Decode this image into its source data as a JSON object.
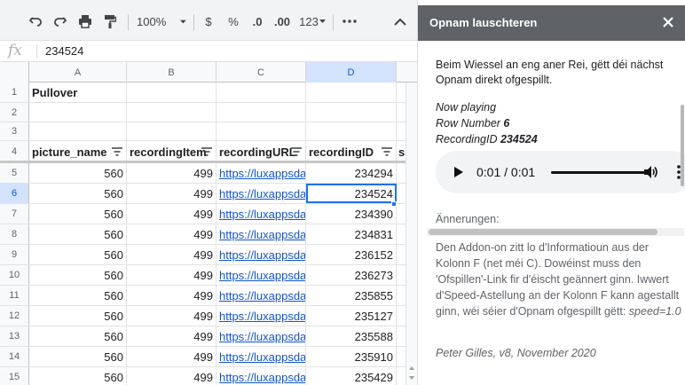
{
  "toolbar": {
    "zoom": "100%",
    "currency": "$",
    "percent": "%",
    "decrease_decimals": ".0",
    "increase_decimals": ".00",
    "more_formats": "123"
  },
  "formula_bar": {
    "fx_label": "fx",
    "value": "234524"
  },
  "sheet": {
    "columns": [
      "A",
      "B",
      "C",
      "D"
    ],
    "title_row_label": "Pullover",
    "header": [
      "picture_name",
      "recordingItem",
      "recordingURL",
      "recordingID"
    ],
    "extra_col_header_fragment": "s",
    "row_numbers": [
      "1",
      "2",
      "3",
      "4",
      "5",
      "6",
      "7",
      "8",
      "9",
      "10",
      "11",
      "12",
      "13",
      "14",
      "15"
    ],
    "rows": [
      {
        "a": "560",
        "b": "499",
        "c": "https://luxappsdata",
        "d": "234294"
      },
      {
        "a": "560",
        "b": "499",
        "c": "https://luxappsdata",
        "d": "234524"
      },
      {
        "a": "560",
        "b": "499",
        "c": "https://luxappsdata",
        "d": "234390"
      },
      {
        "a": "560",
        "b": "499",
        "c": "https://luxappsdata",
        "d": "234831"
      },
      {
        "a": "560",
        "b": "499",
        "c": "https://luxappsdata",
        "d": "236152"
      },
      {
        "a": "560",
        "b": "499",
        "c": "https://luxappsdata",
        "d": "236273"
      },
      {
        "a": "560",
        "b": "499",
        "c": "https://luxappsdata",
        "d": "235855"
      },
      {
        "a": "560",
        "b": "499",
        "c": "https://luxappsdata",
        "d": "235127"
      },
      {
        "a": "560",
        "b": "499",
        "c": "https://luxappsdata",
        "d": "235588"
      },
      {
        "a": "560",
        "b": "499",
        "c": "https://luxappsdata",
        "d": "235910"
      },
      {
        "a": "560",
        "b": "499",
        "c": "https://luxappsdata",
        "d": "235429"
      }
    ]
  },
  "panel": {
    "title": "Opnam lauschteren",
    "intro": "Beim Wiessel an eng aner Rei, gëtt déi nächst Opnam direkt ofgespillt.",
    "now_playing_label": "Now playing",
    "row_number_label": "Row Number",
    "row_number_value": "6",
    "recording_id_label": "RecordingID",
    "recording_id_value": "234524",
    "audio_time": "0:01 / 0:01",
    "notes_label": "Ännerungen:",
    "notes_text": "Den Addon-on zitt lo d'Informatioun aus der Kolonn F (net méi C). Dowéinst muss den 'Ofspillen'-Link fir d'éischt geännert ginn. Iwwert d'Speed-Astellung an der Kolonn F kann agestallt ginn, wéi séier d'Opnam ofgespillt gëtt:",
    "notes_speed": "speed=1.0",
    "credit": "Peter Gilles, v8, November 2020"
  },
  "icons": {
    "undo": "undo-icon",
    "redo": "redo-icon",
    "print": "print-icon",
    "paint_format": "paint-format-icon",
    "more": "more-vert-icon",
    "collapse": "chevron-up-icon",
    "close": "close-icon",
    "play": "play-icon",
    "volume": "volume-icon",
    "filter": "filter-icon"
  },
  "colors": {
    "panel_header": "#5f6368",
    "selection": "#1a73e8",
    "link": "#1155cc"
  }
}
